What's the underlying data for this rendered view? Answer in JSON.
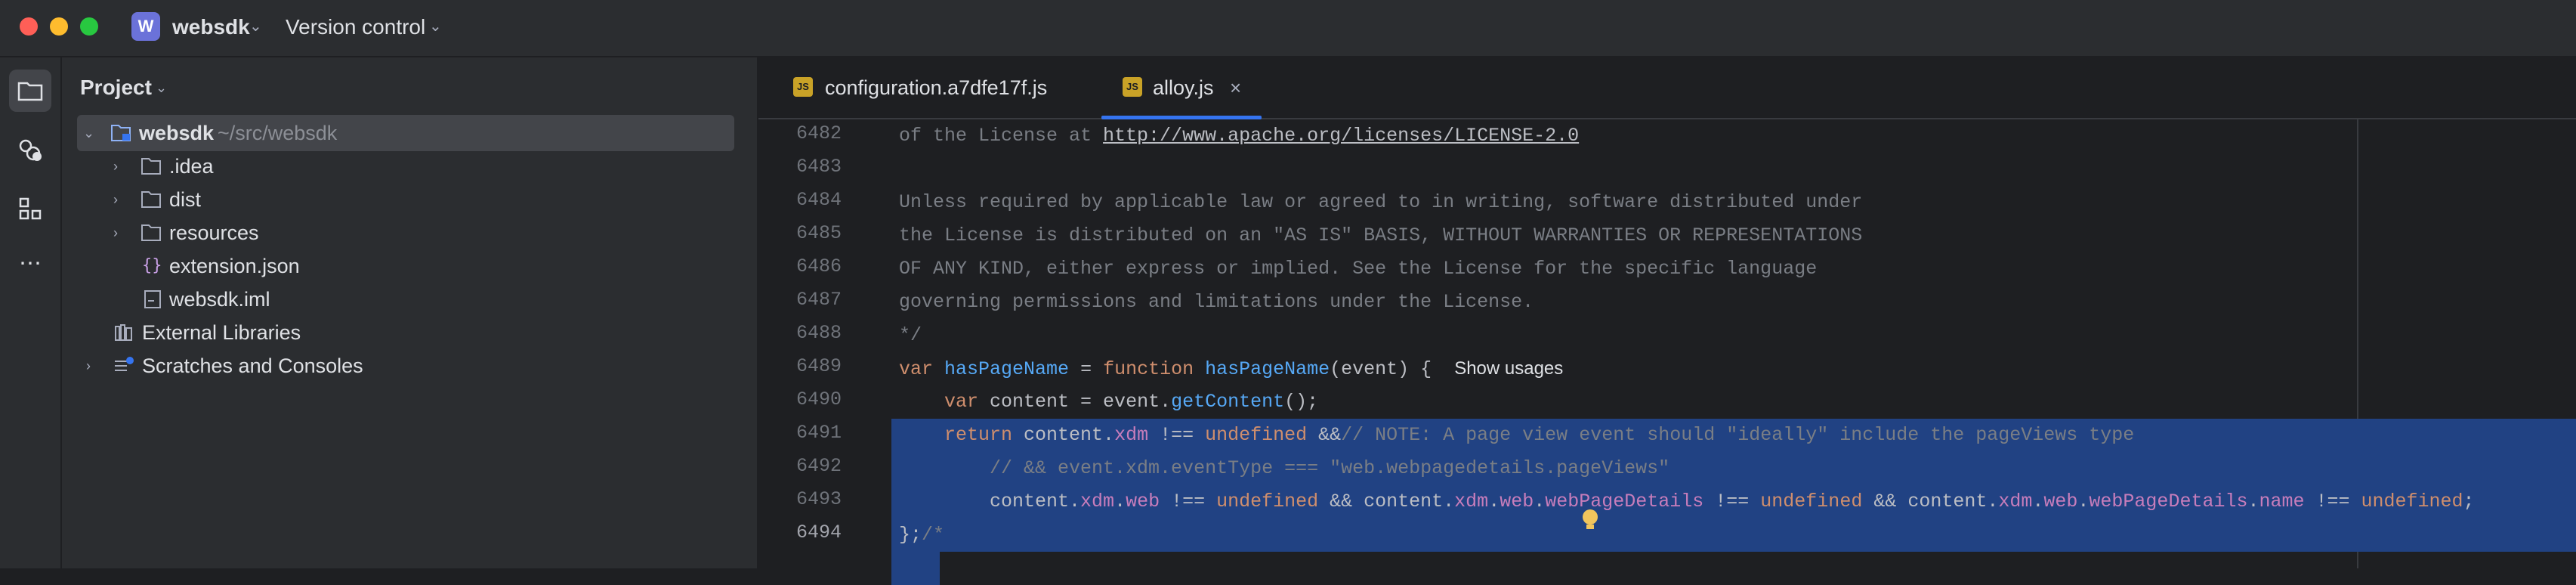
{
  "titlebar": {
    "project_badge": "W",
    "project_name": "websdk",
    "vcs_label": "Version control"
  },
  "toolstrip": {
    "icons": [
      "folder-icon",
      "plugins-icon",
      "structure-icon",
      "more-icon"
    ]
  },
  "project_panel": {
    "title": "Project",
    "tree": [
      {
        "label": "websdk",
        "path": "~/src/websdk"
      },
      {
        "label": ".idea"
      },
      {
        "label": "dist"
      },
      {
        "label": "resources"
      },
      {
        "label": "extension.json"
      },
      {
        "label": "websdk.iml"
      },
      {
        "label": "External Libraries"
      },
      {
        "label": "Scratches and Consoles"
      }
    ]
  },
  "editor": {
    "tabs": [
      {
        "label": "configuration.a7dfe17f.js",
        "icon": "JS"
      },
      {
        "label": "alloy.js",
        "icon": "JS"
      }
    ],
    "line_numbers": [
      "6482",
      "6483",
      "6484",
      "6485",
      "6486",
      "6487",
      "6488",
      "6489",
      "6490",
      "6491",
      "6492",
      "6493",
      "6494"
    ],
    "code": {
      "l6482_a": "of the License at ",
      "l6482_url": "http://www.apache.org/licenses/LICENSE-2.0",
      "l6484": "Unless required by applicable law or agreed to in writing, software distributed under",
      "l6485": "the License is distributed on an \"AS IS\" BASIS, WITHOUT WARRANTIES OR REPRESENTATIONS",
      "l6486": "OF ANY KIND, either express or implied. See the License for the specific language",
      "l6487": "governing permissions and limitations under the License.",
      "l6488": "*/",
      "show_usages": "Show usages"
    }
  },
  "colors": {
    "accent": "#3574f0",
    "selection": "#214283",
    "keyword": "#cf8e6d",
    "function": "#56a8f5",
    "property": "#c77dbb",
    "string": "#6aab73",
    "comment": "#7a7e85"
  }
}
